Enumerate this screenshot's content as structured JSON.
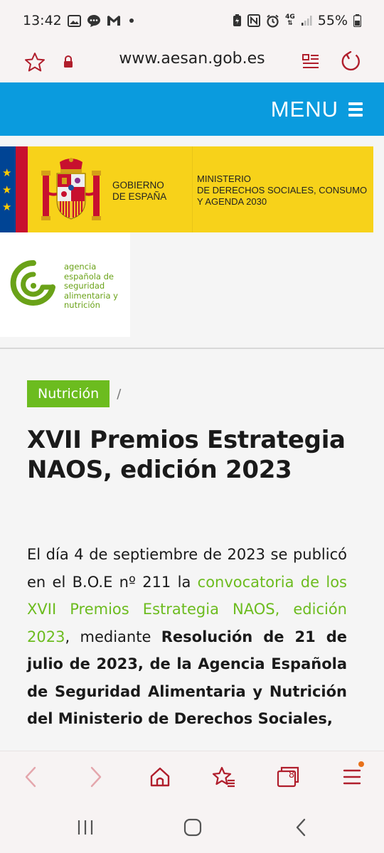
{
  "status_bar": {
    "time": "13:42",
    "network": "4G",
    "battery": "55%"
  },
  "browser": {
    "url": "www.aesan.gob.es",
    "tab_count": "8"
  },
  "header": {
    "menu_label": "MENU"
  },
  "gov_banner": {
    "gobierno_line1": "GOBIERNO",
    "gobierno_line2": "DE ESPAÑA",
    "ministerio_line1": "MINISTERIO",
    "ministerio_line2": "DE DERECHOS SOCIALES, CONSUMO",
    "ministerio_line3": "Y AGENDA 2030"
  },
  "agency_logo": {
    "line1": "agencia",
    "line2": "española de",
    "line3": "seguridad",
    "line4": "alimentaria y",
    "line5": "nutrición"
  },
  "breadcrumb": {
    "tag": "Nutrición",
    "separator": "/"
  },
  "article": {
    "title": "XVII Premios Estrategia NAOS, edición 2023",
    "p1_intro": "El día 4 de septiembre de 2023 se publicó en el B.O.E nº 211 la ",
    "p1_link": "convocatoria de los XVII Premios Estrategia NAOS, edición 2023",
    "p1_mid": ", mediante ",
    "p1_bold": "Resolución de 21 de julio de 2023, de la Agencia Española de Seguridad Alimentaria y Nutrición del Ministerio de Derechos Sociales,"
  },
  "colors": {
    "header_blue": "#0a9bde",
    "brand_green": "#6cbc1f",
    "browser_accent": "#b01e2c",
    "gov_yellow": "#f7d21a"
  }
}
